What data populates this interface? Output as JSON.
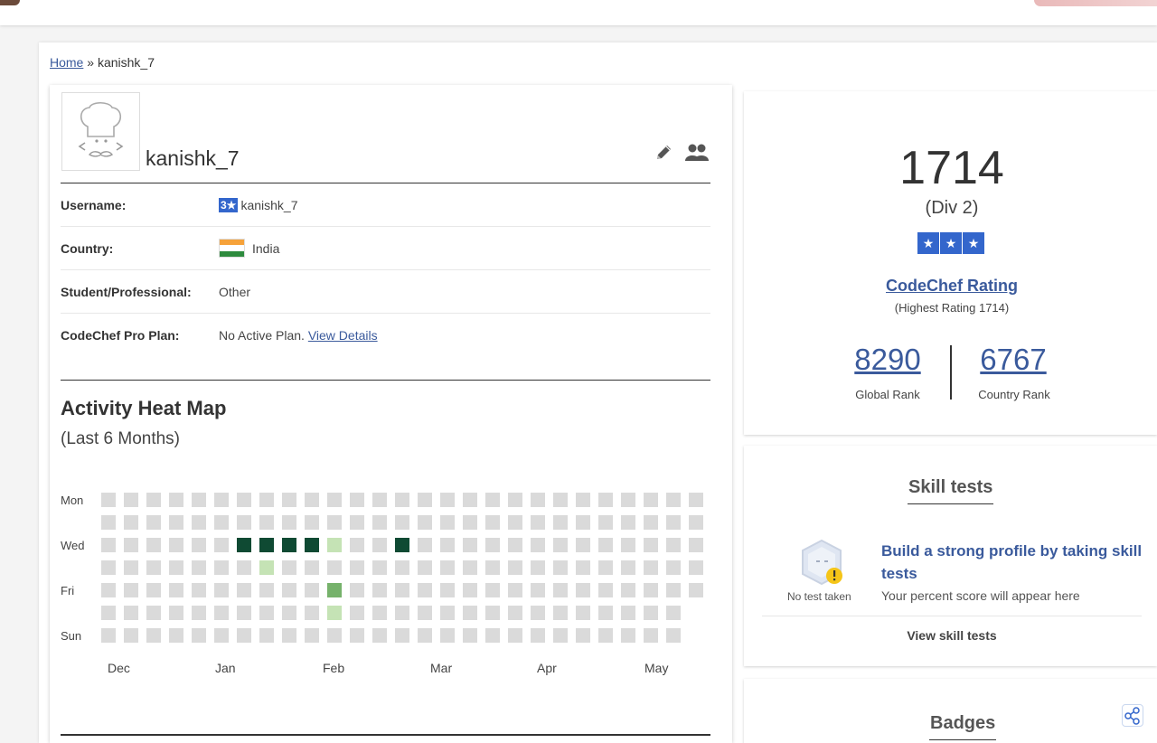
{
  "breadcrumb": {
    "home": "Home",
    "separator": "»",
    "current": "kanishk_7"
  },
  "profile": {
    "display_name": "kanishk_7",
    "avatar_icon": "chef-avatar-icon",
    "rows": [
      {
        "label": "Username:",
        "badge": "3★",
        "value": "kanishk_7"
      },
      {
        "label": "Country:",
        "value": "India"
      },
      {
        "label": "Student/Professional:",
        "value": "Other"
      },
      {
        "label": "CodeChef Pro Plan:",
        "value": "No Active Plan.",
        "link": "View Details"
      }
    ]
  },
  "heatmap": {
    "title": "Activity Heat Map",
    "subtitle": "(Last 6 Months)",
    "day_labels": [
      "Mon",
      "Wed",
      "Fri",
      "Sun"
    ],
    "month_labels": [
      "Dec",
      "Jan",
      "Feb",
      "Mar",
      "Apr",
      "May"
    ],
    "weeks": 27,
    "days": 7,
    "last_week_days": 5,
    "colors": {
      "empty": "#dadada",
      "light": "#c5e3b5",
      "medium": "#76b26b",
      "dark": "#0f4a33"
    },
    "active_cells": [
      {
        "week": 6,
        "day": 2,
        "level": "dark"
      },
      {
        "week": 7,
        "day": 2,
        "level": "dark"
      },
      {
        "week": 8,
        "day": 2,
        "level": "dark"
      },
      {
        "week": 9,
        "day": 2,
        "level": "dark"
      },
      {
        "week": 10,
        "day": 2,
        "level": "light"
      },
      {
        "week": 13,
        "day": 2,
        "level": "dark"
      },
      {
        "week": 7,
        "day": 3,
        "level": "light"
      },
      {
        "week": 10,
        "day": 4,
        "level": "medium"
      },
      {
        "week": 10,
        "day": 5,
        "level": "light"
      }
    ]
  },
  "rating": {
    "value": "1714",
    "division": "(Div 2)",
    "stars": [
      "★",
      "★",
      "★"
    ],
    "label": "CodeChef Rating",
    "highest": "(Highest Rating 1714)",
    "global_rank": "8290",
    "global_rank_label": "Global Rank",
    "country_rank": "6767",
    "country_rank_label": "Country Rank"
  },
  "skill_tests": {
    "title": "Skill tests",
    "status": "No test taken",
    "headline": "Build a strong profile by taking skill tests",
    "note": "Your percent score will appear here",
    "link": "View skill tests"
  },
  "badges": {
    "title": "Badges"
  },
  "colors": {
    "link": "#3a5a9c",
    "star_blue": "#3366cc"
  }
}
